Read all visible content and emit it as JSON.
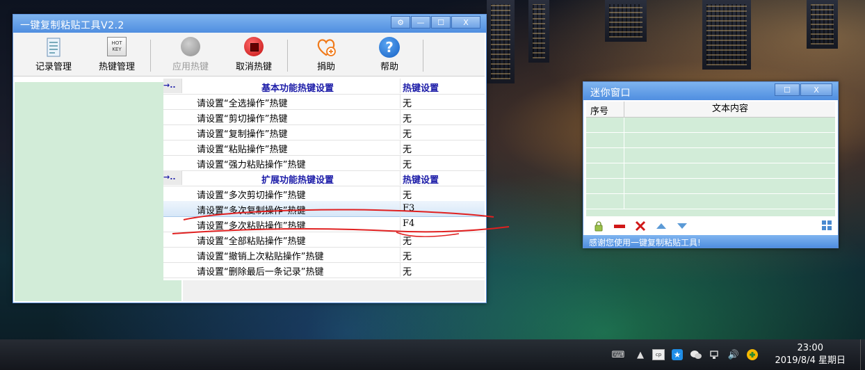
{
  "main_window": {
    "title": "一键复制粘贴工具V2.2",
    "controls": {
      "settings": "⚙",
      "minimize": "—",
      "maximize": "☐",
      "close": "X"
    }
  },
  "toolbar": {
    "record_manage": "记录管理",
    "hotkey_manage": "热键管理",
    "hotkey_icon_text": "HOT KEY",
    "apply_hotkey": "应用热键",
    "cancel_hotkey": "取消热键",
    "donate": "捐助",
    "help": "帮助",
    "help_icon_text": "?"
  },
  "hotkey_table": {
    "collapse_glyph": "→..",
    "sections": [
      {
        "title": "基本功能热键设置",
        "key_header": "热键设置",
        "rows": [
          {
            "label": "请设置“全选操作”热键",
            "key": "无"
          },
          {
            "label": "请设置“剪切操作”热键",
            "key": "无"
          },
          {
            "label": "请设置“复制操作”热键",
            "key": "无"
          },
          {
            "label": "请设置“粘贴操作”热键",
            "key": "无"
          },
          {
            "label": "请设置“强力粘贴操作”热键",
            "key": "无"
          }
        ]
      },
      {
        "title": "扩展功能热键设置",
        "key_header": "热键设置",
        "rows": [
          {
            "label": "请设置“多次剪切操作”热键",
            "key": "无"
          },
          {
            "label": "请设置“多次复制操作”热键",
            "key": "F3"
          },
          {
            "label": "请设置“多次粘贴操作”热键",
            "key": "F4"
          },
          {
            "label": "请设置“全部粘贴操作”热键",
            "key": "无"
          },
          {
            "label": "请设置“撤销上次粘贴操作”热键",
            "key": "无"
          },
          {
            "label": "请设置“删除最后一条记录”热键",
            "key": "无"
          }
        ]
      }
    ]
  },
  "mini_window": {
    "title": "迷你窗口",
    "controls": {
      "maximize": "☐",
      "close": "X"
    },
    "columns": [
      "序号",
      "文本内容"
    ],
    "status": "感谢您使用一键复制粘贴工具!"
  },
  "taskbar": {
    "time": "23:00",
    "date": "2019/8/4 星期日"
  },
  "colors": {
    "titlebar": "#4f8ee0",
    "section_header_text": "#1c1ca8",
    "list_bg": "#d2ecd8",
    "annotation": "#e02020"
  }
}
